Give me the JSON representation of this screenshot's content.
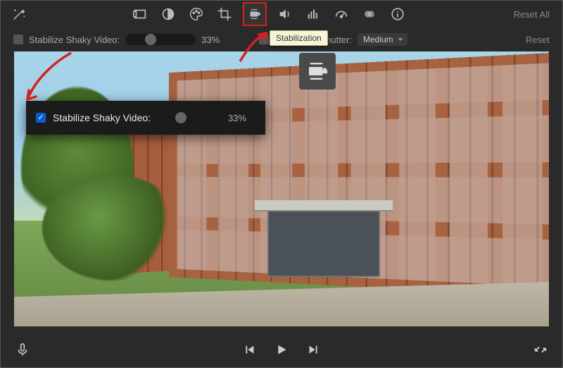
{
  "toolbar": {
    "reset_all_label": "Reset All",
    "icons": {
      "wand": "magic-wand-icon",
      "frame": "frame-icon",
      "contrast": "contrast-icon",
      "palette": "palette-icon",
      "crop": "crop-icon",
      "stabilize": "stabilize-icon",
      "volume": "volume-icon",
      "equalizer": "equalizer-icon",
      "speed": "speed-icon",
      "overlay": "overlay-icon",
      "info": "info-icon"
    }
  },
  "options": {
    "stabilize_label": "Stabilize Shaky Video:",
    "stabilize_percent": "33%",
    "rolling_shutter_label": "Fix Rolling Shutter:",
    "rolling_shutter_value": "Medium",
    "reset_label": "Reset"
  },
  "tooltip_text": "Stabilization",
  "zoomed": {
    "stabilize_label": "Stabilize Shaky Video:",
    "stabilize_percent": "33%"
  },
  "bottom": {
    "mic": "microphone-icon",
    "prev": "previous-icon",
    "play": "play-icon",
    "next": "next-icon",
    "fullscreen": "fullscreen-icon"
  },
  "colors": {
    "highlight": "#d62020",
    "accent_blue": "#0a5bd6"
  }
}
